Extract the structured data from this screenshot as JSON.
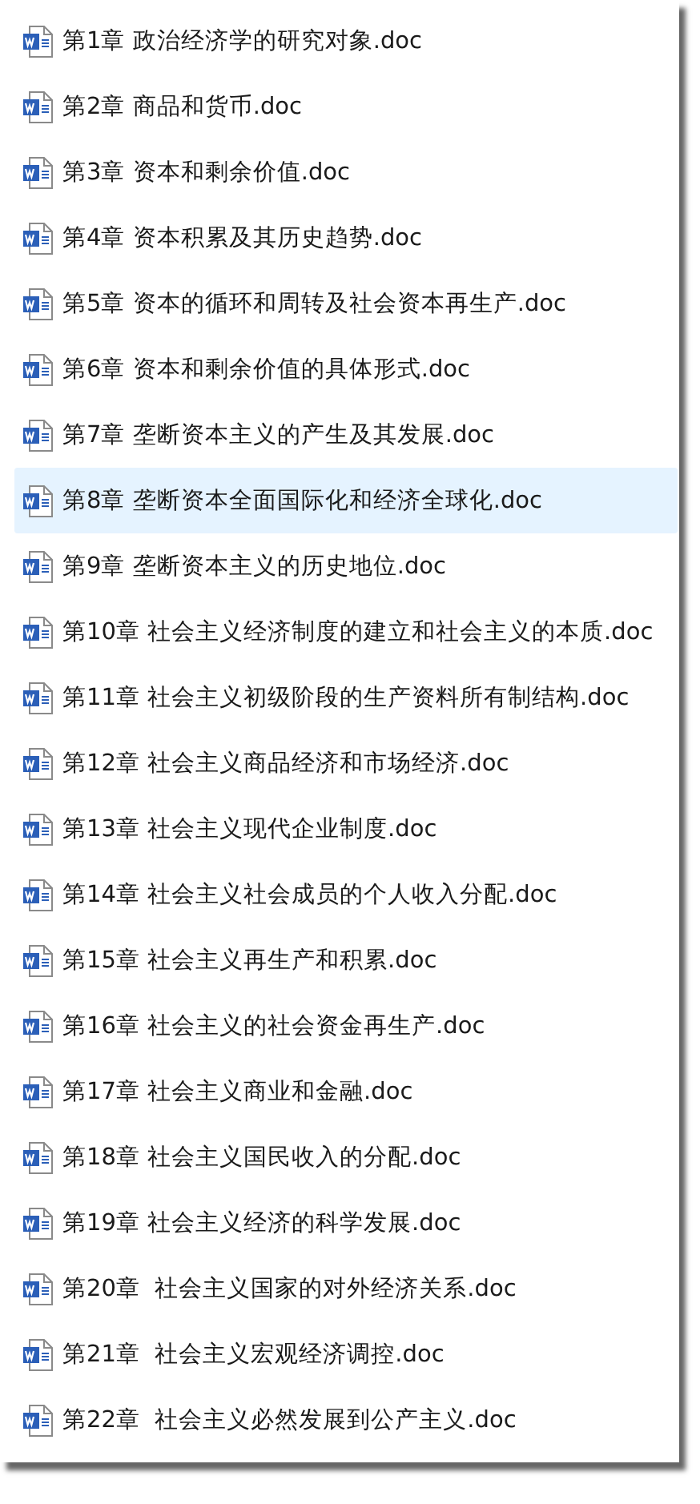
{
  "files": [
    {
      "name": "第1章 政治经济学的研究对象.doc",
      "selected": false
    },
    {
      "name": "第2章 商品和货币.doc",
      "selected": false
    },
    {
      "name": "第3章 资本和剩余价值.doc",
      "selected": false
    },
    {
      "name": "第4章 资本积累及其历史趋势.doc",
      "selected": false
    },
    {
      "name": "第5章 资本的循环和周转及社会资本再生产.doc",
      "selected": false
    },
    {
      "name": "第6章 资本和剩余价值的具体形式.doc",
      "selected": false
    },
    {
      "name": "第7章 垄断资本主义的产生及其发展.doc",
      "selected": false
    },
    {
      "name": "第8章 垄断资本全面国际化和经济全球化.doc",
      "selected": true
    },
    {
      "name": "第9章 垄断资本主义的历史地位.doc",
      "selected": false
    },
    {
      "name": "第10章 社会主义经济制度的建立和社会主义的本质.doc",
      "selected": false
    },
    {
      "name": "第11章 社会主义初级阶段的生产资料所有制结构.doc",
      "selected": false
    },
    {
      "name": "第12章 社会主义商品经济和市场经济.doc",
      "selected": false
    },
    {
      "name": "第13章 社会主义现代企业制度.doc",
      "selected": false
    },
    {
      "name": "第14章 社会主义社会成员的个人收入分配.doc",
      "selected": false
    },
    {
      "name": "第15章 社会主义再生产和积累.doc",
      "selected": false
    },
    {
      "name": "第16章 社会主义的社会资金再生产.doc",
      "selected": false
    },
    {
      "name": "第17章 社会主义商业和金融.doc",
      "selected": false
    },
    {
      "name": "第18章 社会主义国民收入的分配.doc",
      "selected": false
    },
    {
      "name": "第19章 社会主义经济的科学发展.doc",
      "selected": false
    },
    {
      "name": "第20章  社会主义国家的对外经济关系.doc",
      "selected": false
    },
    {
      "name": "第21章  社会主义宏观经济调控.doc",
      "selected": false
    },
    {
      "name": "第22章  社会主义必然发展到公产主义.doc",
      "selected": false
    }
  ]
}
